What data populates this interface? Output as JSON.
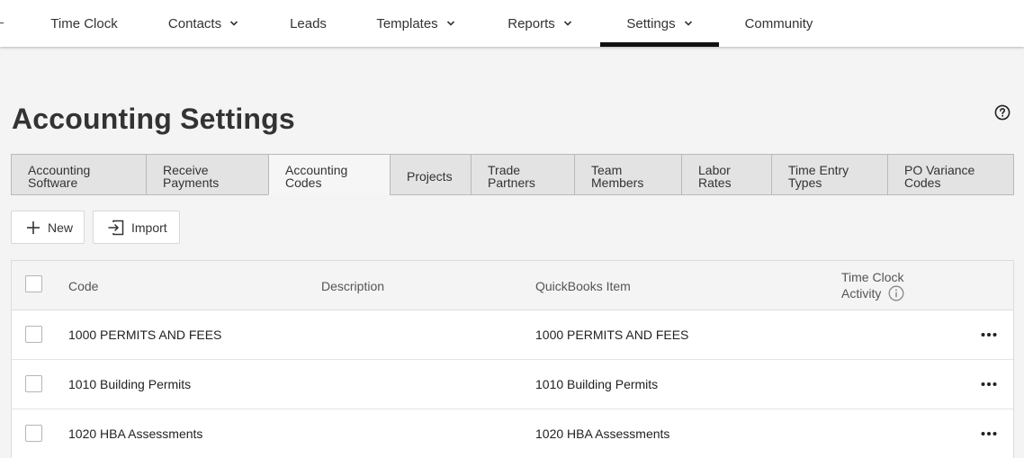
{
  "nav": {
    "items": [
      {
        "label": "Time Clock",
        "has_dropdown": false,
        "active": false
      },
      {
        "label": "Contacts",
        "has_dropdown": true,
        "active": false
      },
      {
        "label": "Leads",
        "has_dropdown": false,
        "active": false
      },
      {
        "label": "Templates",
        "has_dropdown": true,
        "active": false
      },
      {
        "label": "Reports",
        "has_dropdown": true,
        "active": false
      },
      {
        "label": "Settings",
        "has_dropdown": true,
        "active": true
      },
      {
        "label": "Community",
        "has_dropdown": false,
        "active": false
      }
    ]
  },
  "page": {
    "title": "Accounting Settings",
    "help_icon": "question-circle-icon"
  },
  "tabs": [
    {
      "line1": "Accounting",
      "line2": "Software",
      "active": false
    },
    {
      "line1": "Receive",
      "line2": "Payments",
      "active": false
    },
    {
      "line1": "Accounting",
      "line2": "Codes",
      "active": true
    },
    {
      "line1": "Projects",
      "line2": "",
      "active": false
    },
    {
      "line1": "Trade",
      "line2": "Partners",
      "active": false
    },
    {
      "line1": "Team",
      "line2": "Members",
      "active": false
    },
    {
      "line1": "Labor",
      "line2": "Rates",
      "active": false
    },
    {
      "line1": "Time Entry",
      "line2": "Types",
      "active": false
    },
    {
      "line1": "PO Variance",
      "line2": "Codes",
      "active": false
    }
  ],
  "toolbar": {
    "new_label": "New",
    "import_label": "Import"
  },
  "table": {
    "columns": {
      "code": "Code",
      "description": "Description",
      "quickbooks": "QuickBooks Item",
      "time_clock_line1": "Time Clock",
      "time_clock_line2": "Activity"
    },
    "rows": [
      {
        "code": "1000 PERMITS AND FEES",
        "description": "",
        "quickbooks": "1000 PERMITS AND FEES"
      },
      {
        "code": "1010 Building Permits",
        "description": "",
        "quickbooks": "1010 Building Permits"
      },
      {
        "code": "1020 HBA Assessments",
        "description": "",
        "quickbooks": "1020 HBA Assessments"
      }
    ]
  },
  "colors": {
    "nav_bg": "#ffffff",
    "page_bg": "#f4f4f4",
    "active_underline": "#111111",
    "tab_bg": "#e3e3e3",
    "tab_border": "#b9b9b9"
  }
}
